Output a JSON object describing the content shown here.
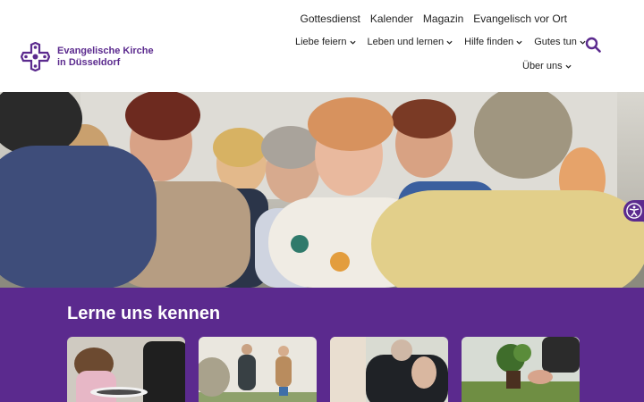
{
  "site": {
    "logo_line1": "Evangelische Kirche",
    "logo_line2": "in Düsseldorf"
  },
  "service_nav": [
    {
      "label": "Gottesdienst"
    },
    {
      "label": "Kalender"
    },
    {
      "label": "Magazin"
    },
    {
      "label": "Evangelisch vor Ort"
    }
  ],
  "main_nav": [
    {
      "label": "Liebe feiern"
    },
    {
      "label": "Leben und lernen"
    },
    {
      "label": "Hilfe finden"
    },
    {
      "label": "Gutes tun"
    },
    {
      "label": "Über uns"
    }
  ],
  "icons": {
    "search": "search-icon",
    "chevron": "chevron-down-icon",
    "accessibility": "accessibility-icon"
  },
  "colors": {
    "brand_purple": "#5b2a8e",
    "text": "#222222"
  },
  "intro": {
    "heading": "Lerne uns kennen"
  }
}
